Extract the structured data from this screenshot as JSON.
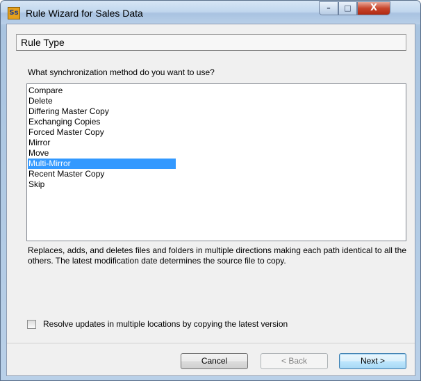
{
  "window": {
    "title": "Rule Wizard for Sales Data",
    "app_icon_text": "Ss",
    "controls": {
      "minimize": "–",
      "maximize": "□",
      "close": "X"
    }
  },
  "section_header": "Rule Type",
  "question": "What synchronization method do you want to use?",
  "methods": [
    "Compare",
    "Delete",
    "Differing Master Copy",
    "Exchanging Copies",
    "Forced Master Copy",
    "Mirror",
    "Move",
    "Multi-Mirror",
    "Recent Master Copy",
    "Skip"
  ],
  "selected_method": "Multi-Mirror",
  "description": "Replaces, adds, and deletes files and folders in multiple directions making each path identical to all the others. The latest modification date determines the source file to copy.",
  "option": {
    "label": "Resolve updates in multiple locations by copying the latest version",
    "checked": false
  },
  "buttons": {
    "cancel": "Cancel",
    "back": "< Back",
    "next": "Next >"
  }
}
